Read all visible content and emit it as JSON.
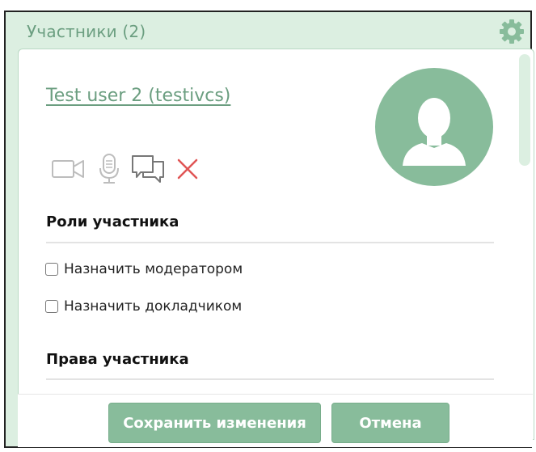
{
  "header": {
    "title": "Участники (2)",
    "settings_icon": "gear-icon"
  },
  "user": {
    "name_link": "Test user 2 (testivcs)",
    "avatar_icon": "user-silhouette-icon"
  },
  "controls": {
    "icons": [
      "video-camera-icon",
      "microphone-icon",
      "chat-bubbles-icon",
      "close-icon"
    ]
  },
  "roles": {
    "title": "Роли участника",
    "options": [
      {
        "label": "Назначить модератором",
        "checked": false
      },
      {
        "label": "Назначить докладчиком",
        "checked": false
      }
    ]
  },
  "rights": {
    "title": "Права участника"
  },
  "buttons": {
    "save_label": "Сохранить изменения",
    "cancel_label": "Отмена"
  },
  "colors": {
    "accent": "#88bc9b",
    "accent_text": "#6b9e80",
    "panel_bg": "#dcefe1",
    "danger": "#e05555",
    "icon_gray": "#bdbdbd"
  }
}
